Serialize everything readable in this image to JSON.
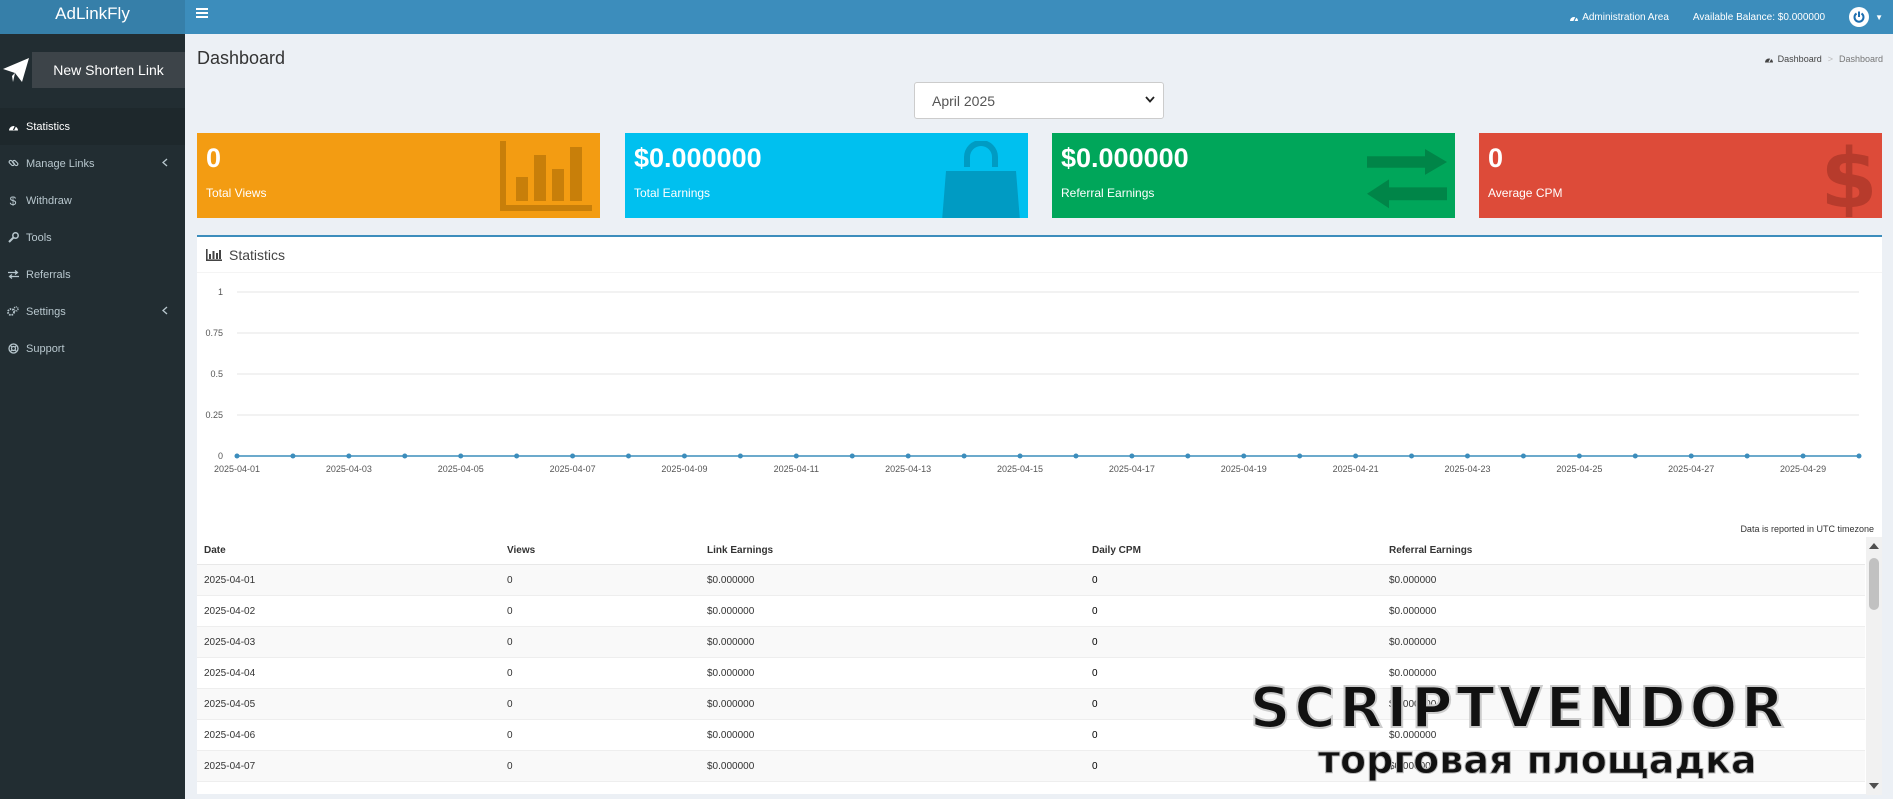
{
  "app": {
    "logo": "AdLinkFly"
  },
  "topbar": {
    "admin_label": "Administration Area",
    "balance_label": "Available Balance: $0.000000"
  },
  "sidebar": {
    "new_link_label": "New Shorten Link",
    "items": [
      {
        "label": "Statistics",
        "icon": "dashboard-icon",
        "active": true
      },
      {
        "label": "Manage Links",
        "icon": "link-icon",
        "submenu": true
      },
      {
        "label": "Withdraw",
        "icon": "dollar-icon"
      },
      {
        "label": "Tools",
        "icon": "wrench-icon"
      },
      {
        "label": "Referrals",
        "icon": "exchange-icon"
      },
      {
        "label": "Settings",
        "icon": "cogs-icon",
        "submenu": true
      },
      {
        "label": "Support",
        "icon": "life-ring-icon"
      }
    ]
  },
  "page": {
    "title": "Dashboard",
    "breadcrumb": [
      "Dashboard",
      "Dashboard"
    ],
    "month_selected": "April 2025"
  },
  "boxes": [
    {
      "value": "0",
      "label": "Total Views",
      "color": "#f39c12",
      "icon": "bar-chart-icon"
    },
    {
      "value": "$0.000000",
      "label": "Total Earnings",
      "color": "#00c0ef",
      "icon": "shopping-bag-icon"
    },
    {
      "value": "$0.000000",
      "label": "Referral Earnings",
      "color": "#00a65a",
      "icon": "exchange-icon"
    },
    {
      "value": "0",
      "label": "Average CPM",
      "color": "#dd4b39",
      "icon": "dollar-icon"
    }
  ],
  "statistics": {
    "title": "Statistics",
    "note": "Data is reported in UTC timezone",
    "table_headers": [
      "Date",
      "Views",
      "Link Earnings",
      "Daily CPM",
      "Referral Earnings"
    ],
    "rows": [
      [
        "2025-04-01",
        "0",
        "$0.000000",
        "0",
        "$0.000000"
      ],
      [
        "2025-04-02",
        "0",
        "$0.000000",
        "0",
        "$0.000000"
      ],
      [
        "2025-04-03",
        "0",
        "$0.000000",
        "0",
        "$0.000000"
      ],
      [
        "2025-04-04",
        "0",
        "$0.000000",
        "0",
        "$0.000000"
      ],
      [
        "2025-04-05",
        "0",
        "$0.000000",
        "0",
        "$0.000000"
      ],
      [
        "2025-04-06",
        "0",
        "$0.000000",
        "0",
        "$0.000000"
      ],
      [
        "2025-04-07",
        "0",
        "$0.000000",
        "0",
        "$0.000000"
      ]
    ]
  },
  "chart_data": {
    "type": "line",
    "x": [
      "2025-04-01",
      "2025-04-02",
      "2025-04-03",
      "2025-04-04",
      "2025-04-05",
      "2025-04-06",
      "2025-04-07",
      "2025-04-08",
      "2025-04-09",
      "2025-04-10",
      "2025-04-11",
      "2025-04-12",
      "2025-04-13",
      "2025-04-14",
      "2025-04-15",
      "2025-04-16",
      "2025-04-17",
      "2025-04-18",
      "2025-04-19",
      "2025-04-20",
      "2025-04-21",
      "2025-04-22",
      "2025-04-23",
      "2025-04-24",
      "2025-04-25",
      "2025-04-26",
      "2025-04-27",
      "2025-04-28",
      "2025-04-29",
      "2025-04-30"
    ],
    "series": [
      {
        "values": [
          0,
          0,
          0,
          0,
          0,
          0,
          0,
          0,
          0,
          0,
          0,
          0,
          0,
          0,
          0,
          0,
          0,
          0,
          0,
          0,
          0,
          0,
          0,
          0,
          0,
          0,
          0,
          0,
          0,
          0
        ]
      }
    ],
    "x_tick_labels": [
      "2025-04-01",
      "2025-04-03",
      "2025-04-05",
      "2025-04-07",
      "2025-04-09",
      "2025-04-11",
      "2025-04-13",
      "2025-04-15",
      "2025-04-17",
      "2025-04-19",
      "2025-04-21",
      "2025-04-23",
      "2025-04-25",
      "2025-04-27",
      "2025-04-29"
    ],
    "y_ticks": [
      "1",
      "0.75",
      "0.5",
      "0.25",
      "0"
    ],
    "ylim": [
      0,
      1
    ],
    "grid": true,
    "line_color": "#3c8dbc"
  },
  "watermark": {
    "title": "SCRIPTVENDOR",
    "subtitle": "торговая площадка"
  }
}
